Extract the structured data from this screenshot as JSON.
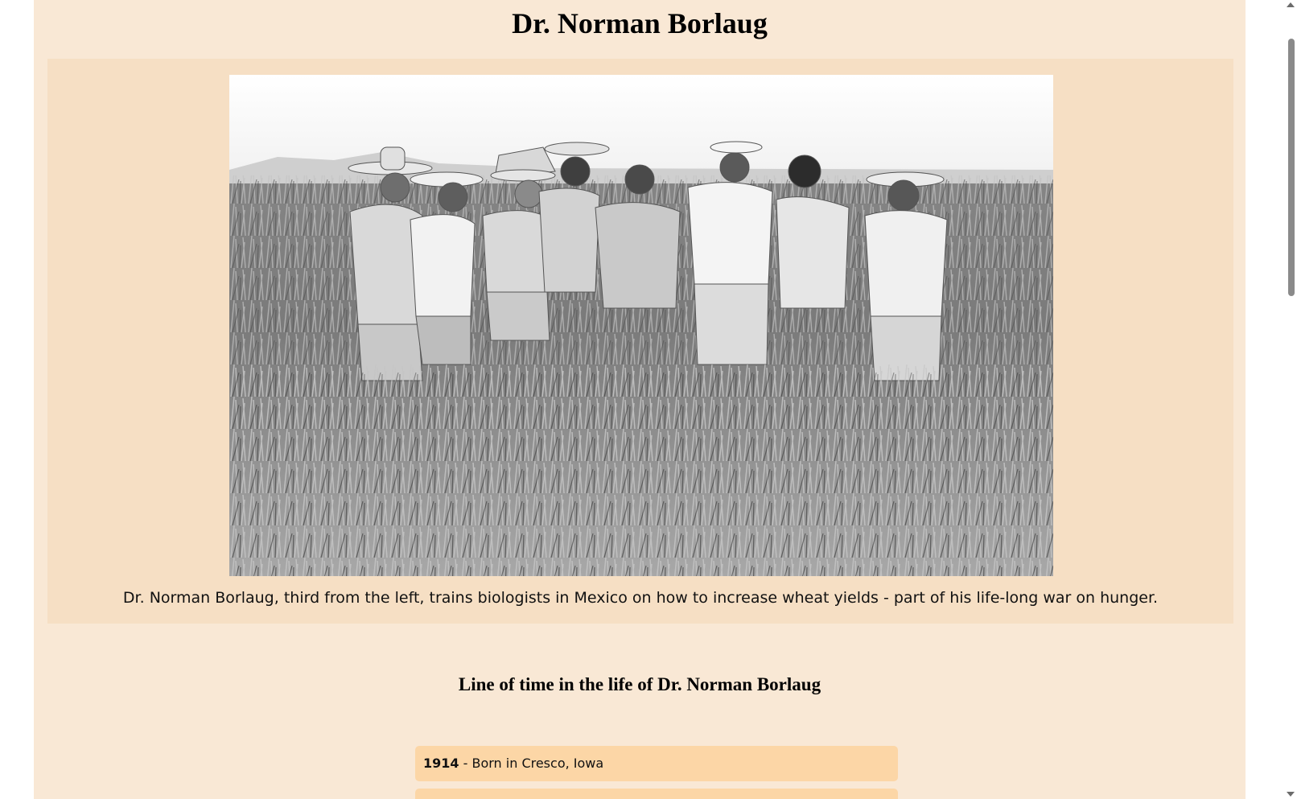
{
  "page": {
    "title": "Dr. Norman Borlaug"
  },
  "figure": {
    "image_alt": "Black and white photo of men in hats standing in a wheat field",
    "caption": "Dr. Norman Borlaug, third from the left, trains biologists in Mexico on how to increase wheat yields - part of his life-long war on hunger."
  },
  "timeline": {
    "heading": "Line of time in the life of Dr. Norman Borlaug",
    "items": [
      {
        "year": "1914",
        "text": " - Born in Cresco, Iowa"
      },
      {
        "year": "",
        "text": ""
      }
    ]
  },
  "colors": {
    "page_bg": "#f9e8d5",
    "figure_bg": "#f6dfc4",
    "timeline_item_bg": "#fcd6a6"
  }
}
